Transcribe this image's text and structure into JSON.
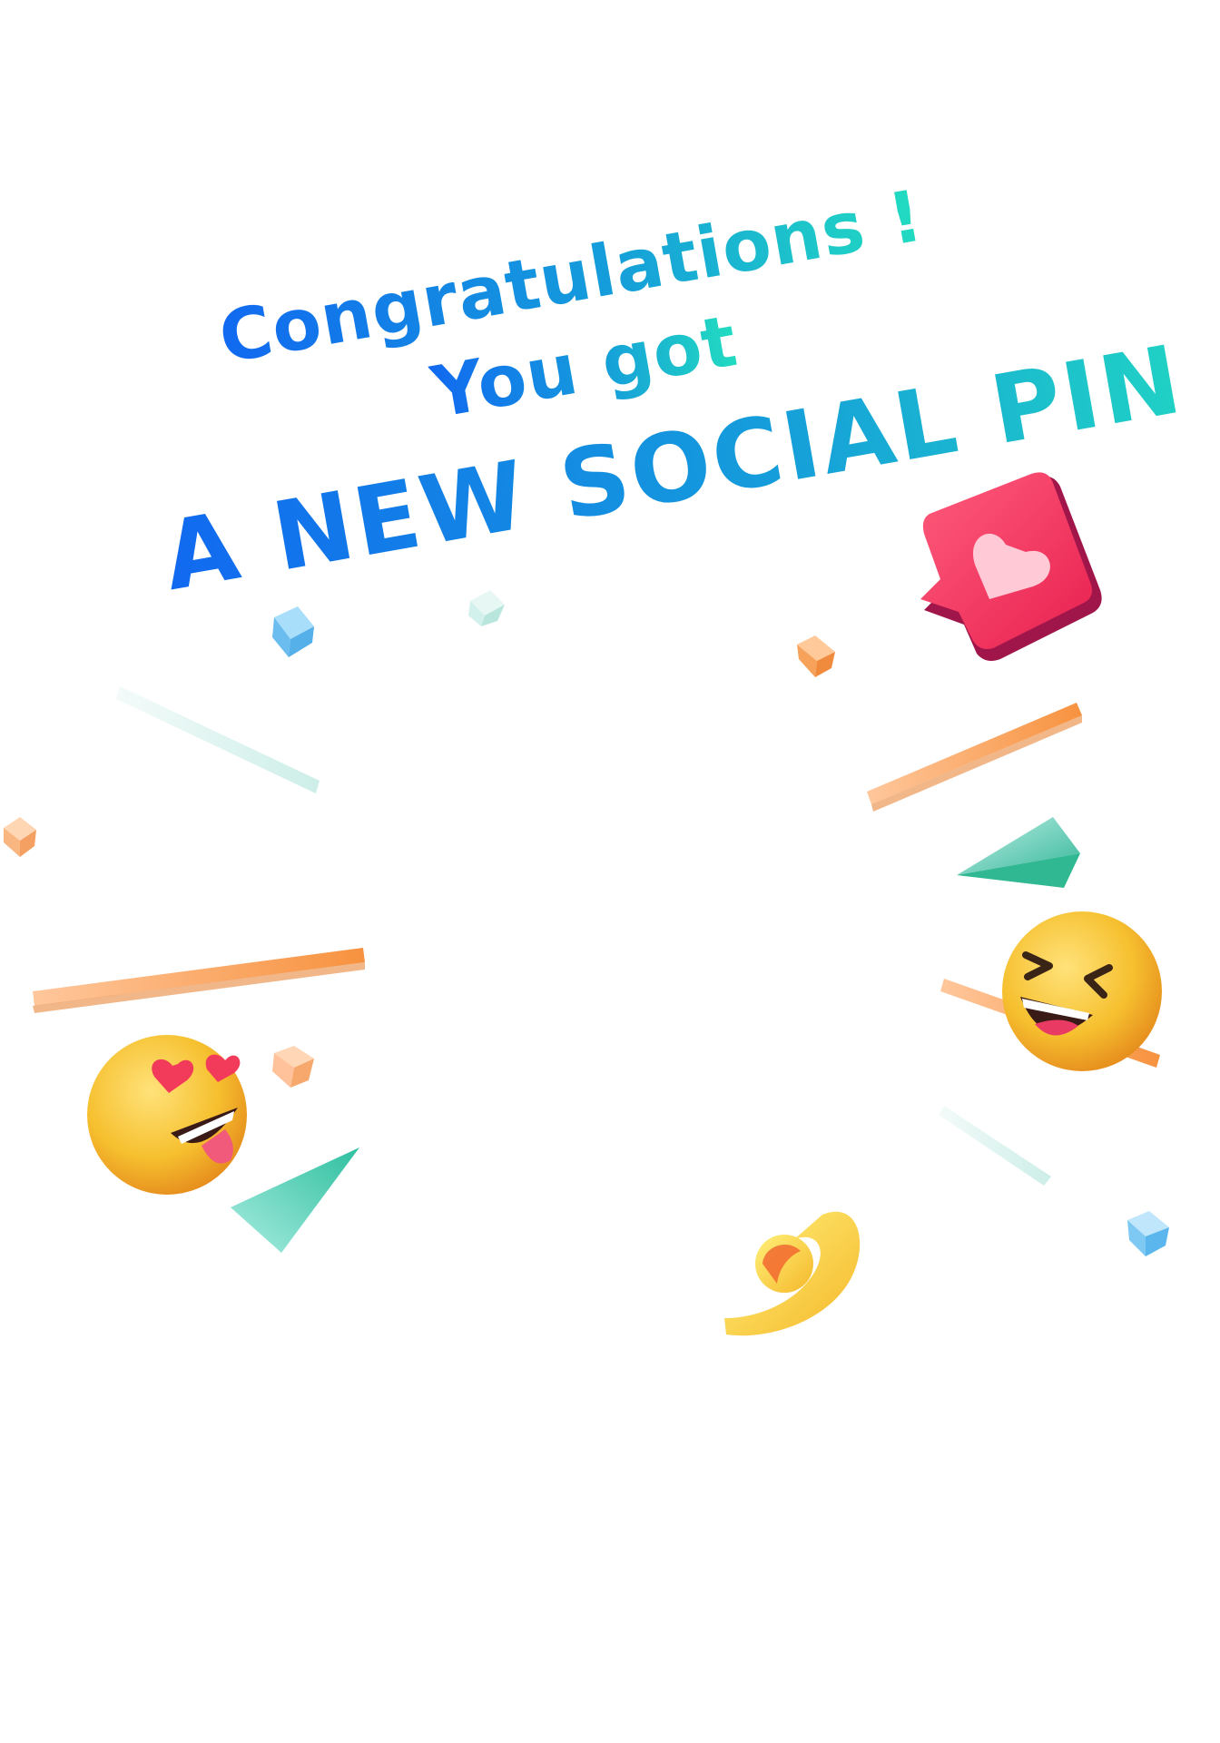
{
  "headline": {
    "line1": "Congratulations !",
    "line2": "You got",
    "line3": "A NEW SOCIAL PIN !"
  },
  "colors": {
    "background": "#ffffff",
    "gradient_start": "#1169f0",
    "gradient_mid": "#159ddb",
    "gradient_end": "#22dcc0",
    "heart_badge": "#f0365f",
    "emoji_yellow": "#f6c02f",
    "orange_accent": "#f7a25a",
    "teal_accent": "#4cc9b0",
    "blue_cube": "#7cc8f4"
  },
  "icons": {
    "heart_badge": "heart-chat-bubble-icon",
    "emoji_heart_eyes": "heart-eyes-emoji-icon",
    "emoji_laughing": "laughing-emoji-icon",
    "comma_shape": "yellow-comma-icon"
  }
}
